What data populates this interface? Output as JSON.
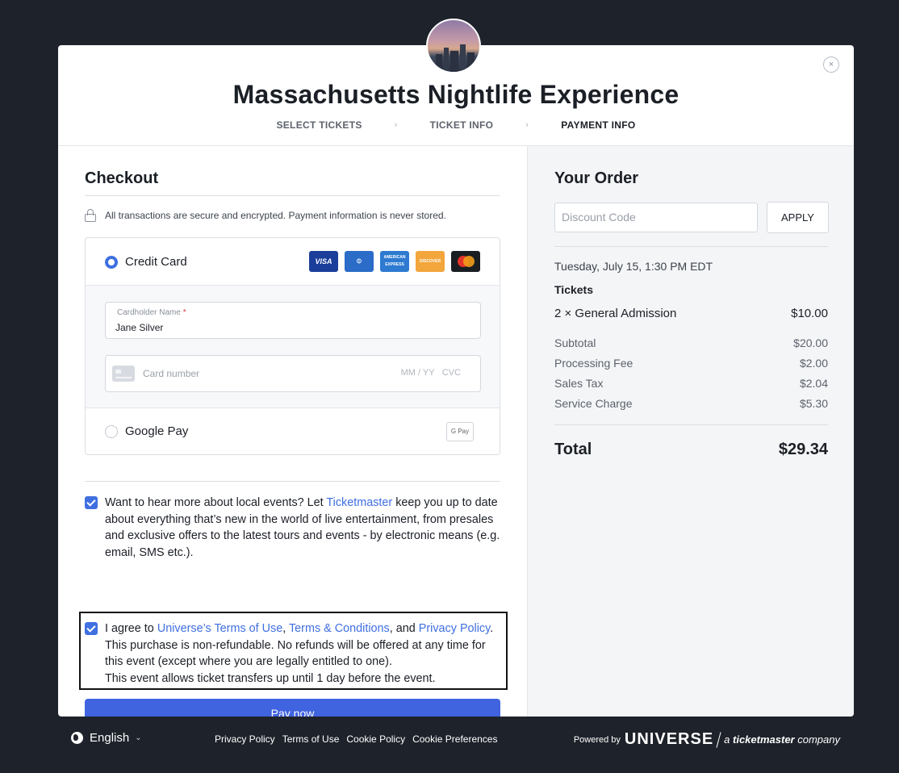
{
  "event": {
    "title": "Massachusetts Nightlife Experience",
    "steps": [
      "SELECT TICKETS",
      "TICKET INFO",
      "PAYMENT INFO"
    ],
    "step_separator": "›"
  },
  "close_label": "×",
  "checkout": {
    "title": "Checkout",
    "secure_note": "All transactions are secure and encrypted. Payment information is never stored.",
    "credit_card_label": "Credit Card",
    "card_brands": [
      "VISA",
      "Diners",
      "American Express",
      "DISCOVER",
      "Mastercard"
    ],
    "cardholder_label": "Cardholder Name",
    "required_mark": "*",
    "cardholder_value": "Jane Silver",
    "card_number_placeholder": "Card number",
    "expiry_placeholder": "MM / YY",
    "cvc_placeholder": "CVC",
    "google_pay_label": "Google Pay",
    "gpay_badge": "G Pay",
    "pay_button": "Pay now"
  },
  "consent": {
    "marketing": {
      "checked": true,
      "before": "Want to hear more about local events? Let ",
      "link": "Ticketmaster",
      "after": " keep you up to date about everything that’s new in the world of live entertainment, from presales and exclusive offers to the latest tours and events - by electronic means (e.g. email, SMS etc.)."
    },
    "terms": {
      "checked": true,
      "t1": "I agree to ",
      "link1": "Universe’s Terms of Use",
      "t2": ", ",
      "link2": "Terms & Conditions",
      "t3": ", and ",
      "link3": "Privacy Policy",
      "t4": ". This purchase is non-refundable. No refunds will be offered at any time for this event (except where you are legally entitled to one).",
      "t5": "This event allows ticket transfers up until 1 day before the event."
    }
  },
  "order": {
    "title": "Your Order",
    "discount_placeholder": "Discount Code",
    "apply_label": "APPLY",
    "date": "Tuesday, July 15, 1:30 PM EDT",
    "tickets_heading": "Tickets",
    "ticket_line": {
      "label": "2 × General Admission",
      "amount": "$10.00"
    },
    "subtotal": {
      "label": "Subtotal",
      "amount": "$20.00"
    },
    "processing_fee": {
      "label": "Processing Fee",
      "amount": "$2.00"
    },
    "sales_tax": {
      "label": "Sales Tax",
      "amount": "$2.04"
    },
    "service_charge": {
      "label": "Service Charge",
      "amount": "$5.30"
    },
    "total": {
      "label": "Total",
      "amount": "$29.34"
    }
  },
  "footer": {
    "language": "English",
    "links": [
      "Privacy Policy",
      "Terms of Use",
      "Cookie Policy",
      "Cookie Preferences"
    ],
    "powered_by": "Powered by",
    "brand": "UNIVERSE",
    "company_prefix": "a ",
    "company_name": "ticketmaster",
    "company_suffix": " company"
  },
  "colors": {
    "accent": "#3f6fe0",
    "pay_button": "#4063e0",
    "page_bg": "#1e222a"
  }
}
